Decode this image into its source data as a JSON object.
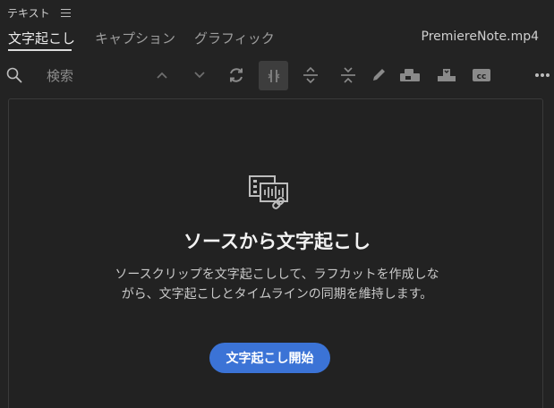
{
  "panel": {
    "title": "テキスト",
    "menu_icon": "hamburger-icon"
  },
  "tabs": [
    {
      "label": "文字起こし",
      "active": true
    },
    {
      "label": "キャプション",
      "active": false
    },
    {
      "label": "グラフィック",
      "active": false
    }
  ],
  "file": {
    "name": "PremiereNote.mp4"
  },
  "toolbar": {
    "search_placeholder": "検索",
    "icons": [
      "search-icon",
      "chevron-up-icon",
      "chevron-down-icon",
      "refresh-icon",
      "split-segment-icon",
      "expand-vertical-icon",
      "collapse-vertical-icon",
      "pencil-icon",
      "speaker-tag-icon",
      "export-icon",
      "cc-icon",
      "more-options-icon"
    ]
  },
  "empty_state": {
    "icon": "film-audio-link-icon",
    "title": "ソースから文字起こし",
    "description": "ソースクリップを文字起こしして、ラフカットを作成しながら、文字起こしとタイムラインの同期を維持します。",
    "button_label": "文字起こし開始"
  },
  "colors": {
    "background": "#232323",
    "accent_button": "#3b73d6",
    "active_tool_bg": "#3d3d3d"
  }
}
